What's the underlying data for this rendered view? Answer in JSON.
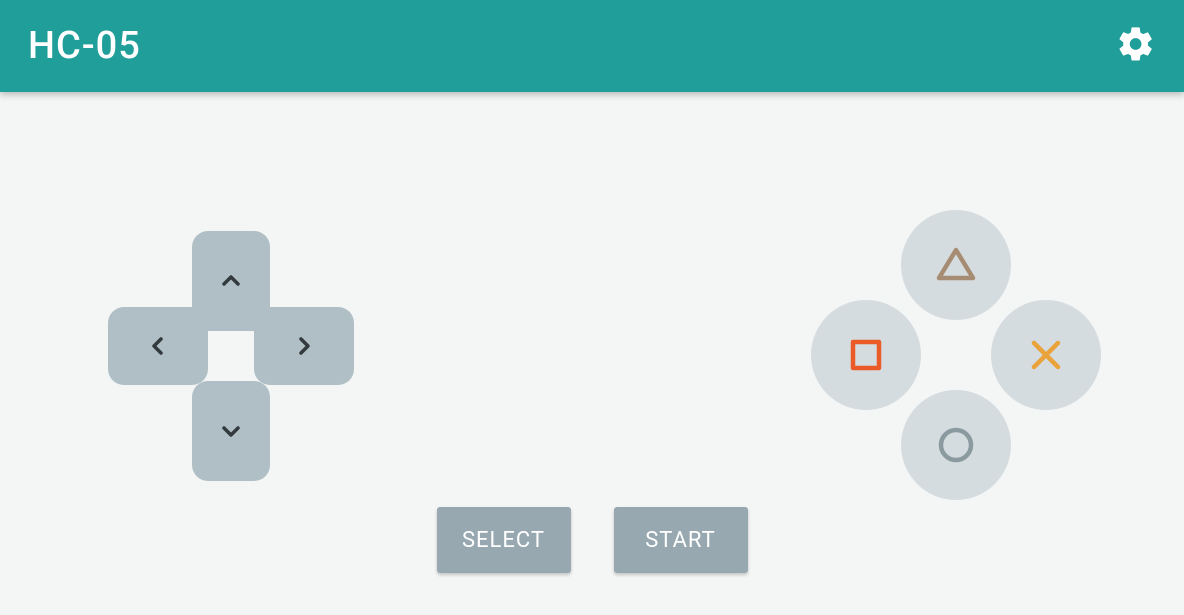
{
  "toolbar": {
    "title": "HC-05"
  },
  "dpad": {
    "up": "chevron-up",
    "down": "chevron-down",
    "left": "chevron-left",
    "right": "chevron-right"
  },
  "face": {
    "top": {
      "shape": "triangle",
      "color": "#a68c73"
    },
    "left": {
      "shape": "square",
      "color": "#ea5b27"
    },
    "right": {
      "shape": "cross",
      "color": "#eaa23b"
    },
    "bottom": {
      "shape": "circle",
      "color": "#8b9a9e"
    }
  },
  "buttons": {
    "select": "SELECT",
    "start": "START"
  }
}
